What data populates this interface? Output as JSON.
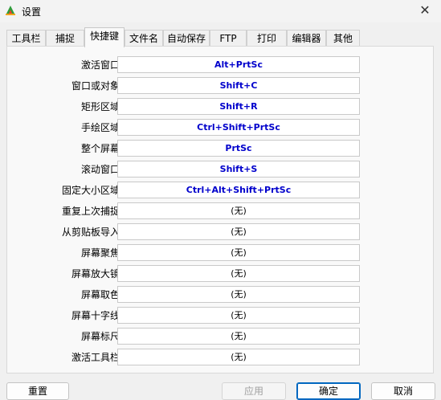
{
  "window": {
    "title": "设置",
    "close_glyph": "✕"
  },
  "tabs": [
    {
      "label": "工具栏"
    },
    {
      "label": "捕捉"
    },
    {
      "label": "快捷键"
    },
    {
      "label": "文件名"
    },
    {
      "label": "自动保存"
    },
    {
      "label": "FTP"
    },
    {
      "label": "打印"
    },
    {
      "label": "编辑器"
    },
    {
      "label": "其他"
    }
  ],
  "active_tab": "快捷键",
  "hotkeys": [
    {
      "label": "激活窗口:",
      "value": "Alt+PrtSc"
    },
    {
      "label": "窗口或对象:",
      "value": "Shift+C"
    },
    {
      "label": "矩形区域:",
      "value": "Shift+R"
    },
    {
      "label": "手绘区域:",
      "value": "Ctrl+Shift+PrtSc"
    },
    {
      "label": "整个屏幕:",
      "value": "PrtSc"
    },
    {
      "label": "滚动窗口:",
      "value": "Shift+S"
    },
    {
      "label": "固定大小区域:",
      "value": "Ctrl+Alt+Shift+PrtSc"
    },
    {
      "label": "重复上次捕捉:",
      "value": "(无)"
    },
    {
      "label": "从剪贴板导入:",
      "value": "(无)"
    },
    {
      "label": "屏幕聚焦:",
      "value": "(无)"
    },
    {
      "label": "屏幕放大镜:",
      "value": "(无)"
    },
    {
      "label": "屏幕取色:",
      "value": "(无)"
    },
    {
      "label": "屏幕十字线:",
      "value": "(无)"
    },
    {
      "label": "屏幕标尺:",
      "value": "(无)"
    },
    {
      "label": "激活工具栏:",
      "value": "(无)"
    }
  ],
  "buttons": {
    "reset": "重置",
    "apply": "应用",
    "ok": "确定",
    "cancel": "取消"
  },
  "colors": {
    "hotkey_set": "#0000cc",
    "accent": "#0067c0"
  }
}
